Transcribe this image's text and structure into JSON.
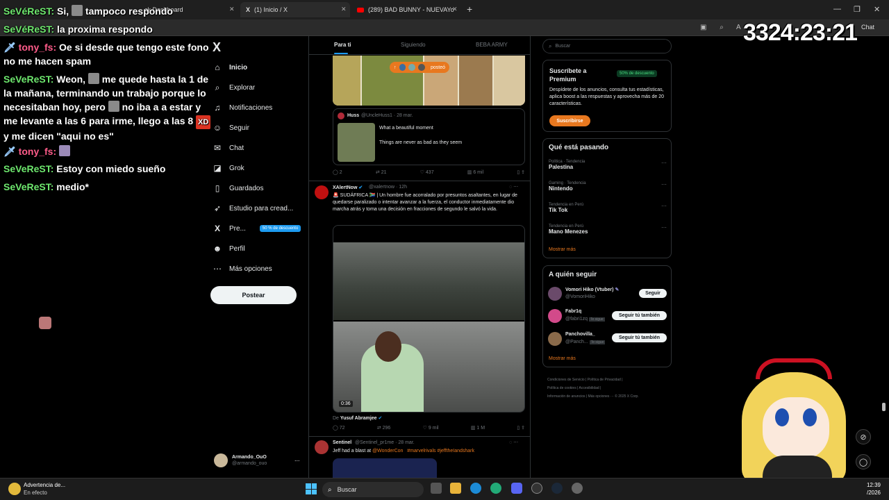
{
  "browser": {
    "tabs": [
      {
        "label": "ck Dashboard"
      },
      {
        "label": "(1) Inicio / X"
      },
      {
        "label": "(289) BAD BUNNY - NUEVAYo"
      }
    ],
    "new_tab": "+",
    "window_controls": [
      "—",
      "❐",
      "✕"
    ],
    "chat_button": "Chat"
  },
  "stream": {
    "timer": "3324:23:21"
  },
  "chat": {
    "messages": [
      {
        "user": "SeVéReST:",
        "text": "Si, ",
        "text2": "tampoco respondo",
        "color": "green"
      },
      {
        "user": "SeVéReST:",
        "text": "la proxima respondo",
        "color": "green"
      },
      {
        "user": "tony_fs:",
        "text": "Oe si desde que tengo este fono no me hacen spam",
        "color": "pink"
      },
      {
        "user": "SeVeReST:",
        "text": "Weon, ",
        "text2": "me quede hasta la 1 de la mañana, terminando un trabajo porque lo necesitaban hoy, pero ",
        "text3": "no iba a a estar y me levante a las 6 para irme, llego a las 8 ",
        "emote": "XD",
        "text4": " y me dicen \"aqui no es\"",
        "color": "green"
      },
      {
        "user": "tony_fs:",
        "text": "",
        "color": "pink"
      },
      {
        "user": "SeVeReST:",
        "text": "Estoy con miedo sueño",
        "color": "green"
      },
      {
        "user": "SeVeReST:",
        "text": "medio*",
        "color": "green"
      }
    ]
  },
  "nav": {
    "logo": "X",
    "items": [
      {
        "label": "Inicio",
        "icon": "home-icon"
      },
      {
        "label": "Explorar",
        "icon": "search-icon"
      },
      {
        "label": "Notificaciones",
        "icon": "bell-icon"
      },
      {
        "label": "Seguir",
        "icon": "person-add-icon"
      },
      {
        "label": "Chat",
        "icon": "mail-icon"
      },
      {
        "label": "Grok",
        "icon": "grok-icon"
      },
      {
        "label": "Guardados",
        "icon": "bookmark-icon"
      },
      {
        "label": "Estudio para cread...",
        "icon": "rocket-icon"
      },
      {
        "label": "Pre...",
        "icon": "x-icon"
      },
      {
        "label": "Perfil",
        "icon": "user-icon"
      },
      {
        "label": "Más opciones",
        "icon": "more-icon"
      }
    ],
    "premium_badge": "50 % de descuento",
    "post_button": "Postear",
    "account": {
      "name": "Armando_OuO",
      "handle": "@armando_ouo",
      "more": "..."
    }
  },
  "feed": {
    "tabs": [
      "Para ti",
      "Siguiendo",
      "BEBA ARMY"
    ],
    "posted_pill": "posteó",
    "quoted": {
      "name": "Huss",
      "handle": "@UncleHuss1 · 28 mar.",
      "text1": "What a beautiful moment",
      "text2": "Things are never as bad as they seem"
    },
    "post1_actions": {
      "replies": "2",
      "reposts": "21",
      "likes": "437",
      "views": "6 mil"
    },
    "post2": {
      "name": "XAlertNow",
      "handle": "@xalertnow · 12h",
      "text": "🚨 SUDÁFRICA 🇿🇦 | Un hombre fue acorralado por presuntos asaltantes, en lugar de quedarse paralizado o intentar avanzar a la fuerza, el conductor inmediatamente dio marcha atrás y toma una decisión en fracciones de segundo le salvó la vida.",
      "video_time": "0:36",
      "from_label": "De",
      "from_name": "Yusuf Abramjee",
      "actions": {
        "replies": "72",
        "reposts": "296",
        "likes": "9 mil",
        "views": "1 M"
      }
    },
    "post3": {
      "name": "Sentinel",
      "handle": "@Sentinel_pr1me · 28 mar.",
      "text_prefix": "Jeff had a blast at ",
      "mention": "@WonderCon",
      "hashtags": "#marvelrivals #jefftheIandshark"
    }
  },
  "right": {
    "search_placeholder": "Buscar",
    "premium": {
      "title": "Suscríbete a Premium",
      "badge": "50% de descuento",
      "desc": "Despídete de los anuncios, consulta tus estadísticas, aplica boost a las respuestas y aprovecha más de 20 características.",
      "button": "Suscribirse"
    },
    "trends": {
      "title": "Qué está pasando",
      "items": [
        {
          "cat": "Política · Tendencia",
          "name": "Palestina"
        },
        {
          "cat": "Gaming · Tendencia",
          "name": "Nintendo"
        },
        {
          "cat": "Tendencia en Perú",
          "name": "Tik Tok"
        },
        {
          "cat": "Tendencia en Perú",
          "name": "Mano Menezes"
        }
      ],
      "more": "Mostrar más"
    },
    "follow": {
      "title": "A quién seguir",
      "items": [
        {
          "name": "Vomori Hiko (Vtuber)",
          "handle": "@VomoriHiko",
          "button": "Seguir"
        },
        {
          "name": "Fabr1q",
          "handle": "@fabri1zq",
          "tag": "Te sigue",
          "button": "Seguir tú también"
        },
        {
          "name": "Panchovilla_",
          "handle": "@Panch...",
          "tag": "Te sigue",
          "button": "Seguir tú también"
        }
      ],
      "more": "Mostrar más"
    },
    "footer": {
      "line1": "Condiciones de Servicio  |  Política de Privacidad  |",
      "line2": "Política de cookies  |  Accesibilidad  |",
      "line3": "Información de anuncios  |  Más opciones ···  © 2025 X Corp."
    }
  },
  "taskbar": {
    "notice_title": "Advertencia de...",
    "notice_sub": "En efecto",
    "search": "Buscar",
    "time": "12:39",
    "date": "/2026"
  }
}
